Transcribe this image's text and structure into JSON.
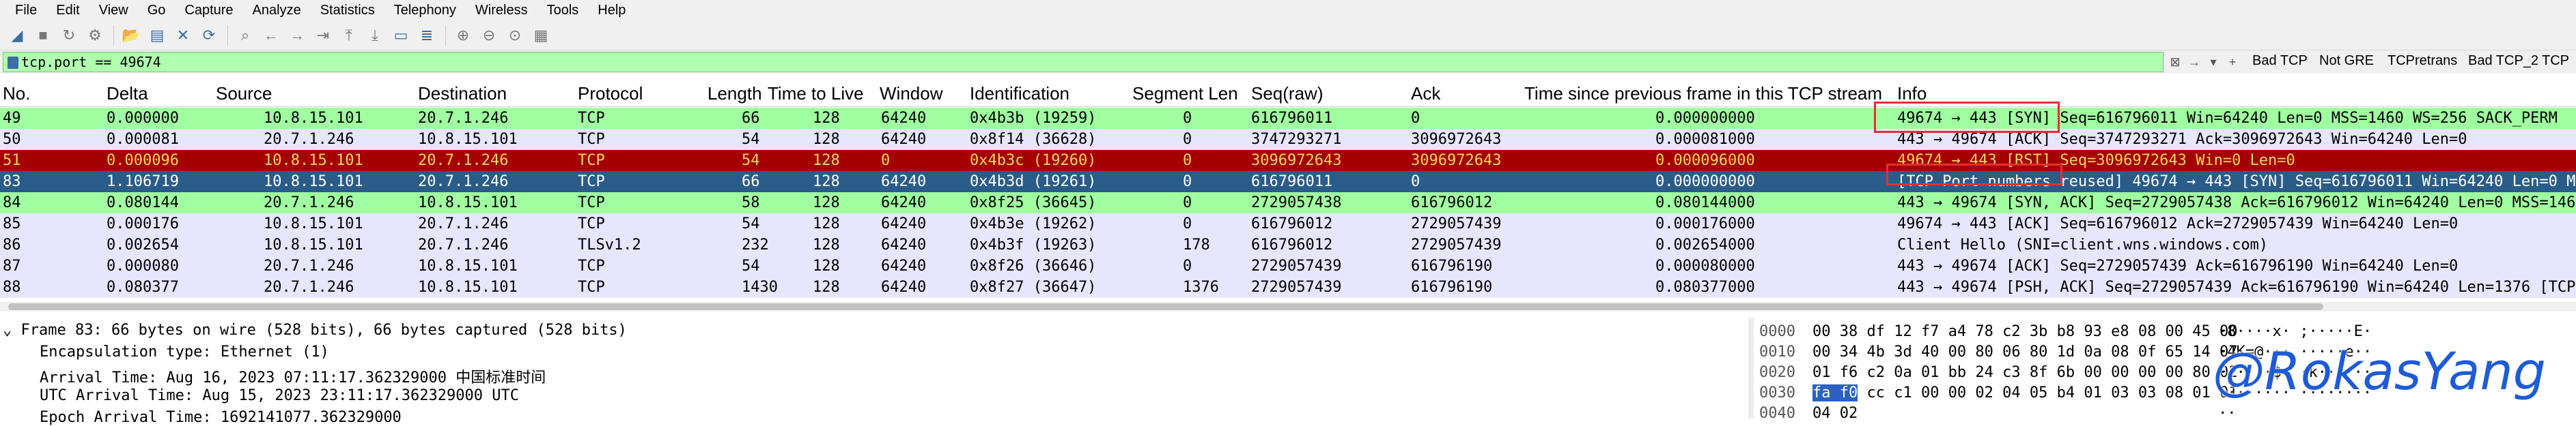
{
  "menu": [
    "File",
    "Edit",
    "View",
    "Go",
    "Capture",
    "Analyze",
    "Statistics",
    "Telephony",
    "Wireless",
    "Tools",
    "Help"
  ],
  "filter": {
    "value": "tcp.port == 49674"
  },
  "filter_buttons": [
    "Bad TCP",
    "Not GRE",
    "TCPretrans",
    "Bad TCP_2",
    "TCP"
  ],
  "columns": [
    "No.",
    "Delta",
    "Source",
    "Destination",
    "Protocol",
    "Length",
    "Time to Live",
    "Window",
    "Identification",
    "Segment Len",
    "Seq(raw)",
    "Ack",
    "Time since previous frame in this TCP stream",
    "Info"
  ],
  "colors": {
    "green": "#a0ffa0",
    "red": "#a40000",
    "selected": "#2a5c8a",
    "lavender": "#e7e6ff",
    "blue_accent": "#2a61c2",
    "watermark": "#1e5bd8"
  },
  "rows": [
    {
      "no": "49",
      "delta": "0.000000",
      "src": "10.8.15.101",
      "dst": "20.7.1.246",
      "proto": "TCP",
      "len": "66",
      "ttl": "128",
      "win": "64240",
      "id": "0x4b3b (19259)",
      "seglen": "0",
      "seq": "616796011",
      "ack": "0",
      "tsp": "0.000000000",
      "info": "49674 → 443 [SYN] Seq=616796011 Win=64240 Len=0 MSS=1460 WS=256 SACK_PERM",
      "style": "green"
    },
    {
      "no": "50",
      "delta": "0.000081",
      "src": "20.7.1.246",
      "dst": "10.8.15.101",
      "proto": "TCP",
      "len": "54",
      "ttl": "128",
      "win": "64240",
      "id": "0x8f14 (36628)",
      "seglen": "0",
      "seq": "3747293271",
      "ack": "3096972643",
      "tsp": "0.000081000",
      "info": "443 → 49674 [ACK] Seq=3747293271 Ack=3096972643 Win=64240 Len=0",
      "style": "lavender"
    },
    {
      "no": "51",
      "delta": "0.000096",
      "src": "10.8.15.101",
      "dst": "20.7.1.246",
      "proto": "TCP",
      "len": "54",
      "ttl": "128",
      "win": "0",
      "id": "0x4b3c (19260)",
      "seglen": "0",
      "seq": "3096972643",
      "ack": "3096972643",
      "tsp": "0.000096000",
      "info": "49674 → 443 [RST] Seq=3096972643 Win=0 Len=0",
      "style": "red"
    },
    {
      "no": "83",
      "delta": "1.106719",
      "src": "10.8.15.101",
      "dst": "20.7.1.246",
      "proto": "TCP",
      "len": "66",
      "ttl": "128",
      "win": "64240",
      "id": "0x4b3d (19261)",
      "seglen": "0",
      "seq": "616796011",
      "ack": "0",
      "tsp": "0.000000000",
      "info": "[TCP Port numbers reused] 49674 → 443 [SYN] Seq=616796011 Win=64240 Len=0 M",
      "style": "selected"
    },
    {
      "no": "84",
      "delta": "0.080144",
      "src": "20.7.1.246",
      "dst": "10.8.15.101",
      "proto": "TCP",
      "len": "58",
      "ttl": "128",
      "win": "64240",
      "id": "0x8f25 (36645)",
      "seglen": "0",
      "seq": "2729057438",
      "ack": "616796012",
      "tsp": "0.080144000",
      "info": "443 → 49674 [SYN, ACK] Seq=2729057438 Ack=616796012 Win=64240 Len=0 MSS=146",
      "style": "green"
    },
    {
      "no": "85",
      "delta": "0.000176",
      "src": "10.8.15.101",
      "dst": "20.7.1.246",
      "proto": "TCP",
      "len": "54",
      "ttl": "128",
      "win": "64240",
      "id": "0x4b3e (19262)",
      "seglen": "0",
      "seq": "616796012",
      "ack": "2729057439",
      "tsp": "0.000176000",
      "info": "49674 → 443 [ACK] Seq=616796012 Ack=2729057439 Win=64240 Len=0",
      "style": "lavender"
    },
    {
      "no": "86",
      "delta": "0.002654",
      "src": "10.8.15.101",
      "dst": "20.7.1.246",
      "proto": "TLSv1.2",
      "len": "232",
      "ttl": "128",
      "win": "64240",
      "id": "0x4b3f (19263)",
      "seglen": "178",
      "seq": "616796012",
      "ack": "2729057439",
      "tsp": "0.002654000",
      "info": "Client Hello (SNI=client.wns.windows.com)",
      "style": "lavender"
    },
    {
      "no": "87",
      "delta": "0.000080",
      "src": "20.7.1.246",
      "dst": "10.8.15.101",
      "proto": "TCP",
      "len": "54",
      "ttl": "128",
      "win": "64240",
      "id": "0x8f26 (36646)",
      "seglen": "0",
      "seq": "2729057439",
      "ack": "616796190",
      "tsp": "0.000080000",
      "info": "443 → 49674 [ACK] Seq=2729057439 Ack=616796190 Win=64240 Len=0",
      "style": "lavender"
    },
    {
      "no": "88",
      "delta": "0.080377",
      "src": "20.7.1.246",
      "dst": "10.8.15.101",
      "proto": "TCP",
      "len": "1430",
      "ttl": "128",
      "win": "64240",
      "id": "0x8f27 (36647)",
      "seglen": "1376",
      "seq": "2729057439",
      "ack": "616796190",
      "tsp": "0.080377000",
      "info": "443 → 49674 [PSH, ACK] Seq=2729057439 Ack=616796190 Win=64240 Len=1376 [TCP",
      "style": "lavender"
    }
  ],
  "details": [
    "Frame 83: 66 bytes on wire (528 bits), 66 bytes captured (528 bits)",
    "Encapsulation type: Ethernet (1)",
    "Arrival Time: Aug 16, 2023 07:11:17.362329000 中国标准时间",
    "UTC Arrival Time: Aug 15, 2023 23:11:17.362329000 UTC",
    "Epoch Arrival Time: 1692141077.362329000"
  ],
  "bytes": [
    {
      "off": "0000",
      "hex": "00 38 df 12 f7 a4 78 c2  3b b8 93 e8 08 00 45 00",
      "asc": "·8····x· ;·····E·"
    },
    {
      "off": "0010",
      "hex": "00 34 4b 3d 40 00 80 06  80 1d 0a 08 0f 65 14 07",
      "asc": "·4K=@··· ·····e··"
    },
    {
      "off": "0020",
      "hex": "01 f6 c2 0a 01 bb 24 c3  8f 6b 00 00 00 00 80 02",
      "asc": "······$· ·k······"
    },
    {
      "off": "0030",
      "hex_hl": "fa f0",
      "hex": " cc c1 00 00 02 04  05 b4 01 03 03 08 01 01",
      "asc": "········ ········"
    },
    {
      "off": "0040",
      "hex": "04 02",
      "asc": "··"
    }
  ],
  "watermark": "@RokasYang"
}
